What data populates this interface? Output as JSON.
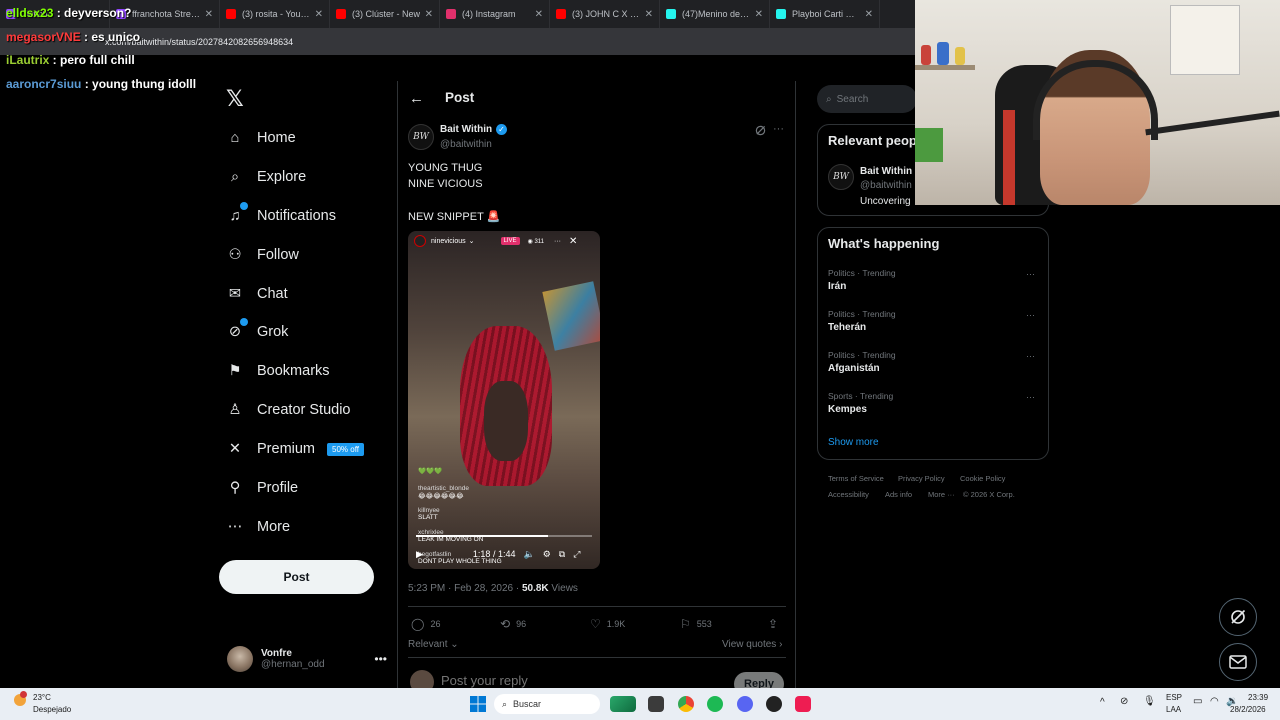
{
  "browser": {
    "tabs": [
      {
        "label": "Twitch",
        "color": "#9146ff"
      },
      {
        "label": "ffranchota Stream",
        "color": "#9146ff"
      },
      {
        "label": "(3) rosita - YouTube",
        "color": "#ff0000"
      },
      {
        "label": "(3) Clúster - New",
        "color": "#ff0000"
      },
      {
        "label": "(4) Instagram",
        "color": "#e1306c"
      },
      {
        "label": "(3) JOHN C X EZE",
        "color": "#ff0000"
      },
      {
        "label": "(47)Menino de Ou",
        "color": "#25f4ee"
      },
      {
        "label": "Playboi Carti Rele",
        "color": "#25f4ee"
      }
    ],
    "url": "x.com/baitwithin/status/2027842082656948634"
  },
  "chat": [
    {
      "user": "elldsx23",
      "color": "#7fff00",
      "text": "deyverson?"
    },
    {
      "user": "megasorVNE",
      "color": "#ff3b3b",
      "text": "es unico"
    },
    {
      "user": "iLautrix",
      "color": "#9acd32",
      "text": "pero full chill"
    },
    {
      "user": "aaroncr7siuu",
      "color": "#5b9bd5",
      "text": "young thung idolll"
    }
  ],
  "nav": {
    "items": [
      {
        "label": "Home",
        "icon": "home-icon",
        "glyph": "⌂"
      },
      {
        "label": "Explore",
        "icon": "search-icon",
        "glyph": "⌕"
      },
      {
        "label": "Notifications",
        "icon": "bell-icon",
        "glyph": "♫"
      },
      {
        "label": "Follow",
        "icon": "person-plus-icon",
        "glyph": "⚇"
      },
      {
        "label": "Chat",
        "icon": "mail-icon",
        "glyph": "✉"
      },
      {
        "label": "Grok",
        "icon": "grok-icon",
        "glyph": "⊘"
      },
      {
        "label": "Bookmarks",
        "icon": "bookmark-icon",
        "glyph": "⚑"
      },
      {
        "label": "Creator Studio",
        "icon": "creator-icon",
        "glyph": "♙"
      },
      {
        "label": "Premium",
        "icon": "x-logo-icon",
        "glyph": "✕"
      },
      {
        "label": "Profile",
        "icon": "person-icon",
        "glyph": "⚲"
      },
      {
        "label": "More",
        "icon": "more-circle-icon",
        "glyph": "⋯"
      }
    ],
    "premium_promo": "50% off",
    "post_button": "Post",
    "account": {
      "name": "Vonfre",
      "handle": "@hernan_odd"
    }
  },
  "post": {
    "header": "Post",
    "author": {
      "name": "Bait Within",
      "handle": "@baitwithin",
      "avatar_text": "BW"
    },
    "text_lines": [
      "YOUNG THUG",
      "NINE VICIOUS",
      "NEW SNIPPET 🚨"
    ],
    "video": {
      "account": "ninevicious",
      "live": "LIVE",
      "viewers": "311",
      "comments": [
        {
          "user": "theartistic_blonde",
          "text": "😂😂😂😂😂😂"
        },
        {
          "user": "killnyee",
          "text": "SLATT"
        },
        {
          "user": "xchrixlee",
          "text": "LEAK IM MOVING ON"
        },
        {
          "user": "hegotfastlin",
          "text": "DONT PLAY WHOLE THING"
        }
      ],
      "time": "1:18 / 1:44",
      "progress": 0.75
    },
    "timestamp": "5:23 PM · Feb 28, 2026 ·",
    "views_count": "50.8K",
    "views_label": "Views",
    "actions": {
      "replies": "26",
      "reposts": "96",
      "likes": "1.9K",
      "bookmarks": "553"
    },
    "sort_label": "Relevant",
    "view_quotes": "View quotes",
    "reply_placeholder": "Post your reply",
    "reply_button": "Reply"
  },
  "sidebar": {
    "search_placeholder": "Search",
    "relevant_title": "Relevant people",
    "relevant_person": {
      "name": "Bait Within",
      "handle": "@baitwithin",
      "bio": "Uncovering"
    },
    "happening_title": "What's happening",
    "trends": [
      {
        "category": "Politics · Trending",
        "name": "Irán"
      },
      {
        "category": "Politics · Trending",
        "name": "Teherán"
      },
      {
        "category": "Politics · Trending",
        "name": "Afganistán"
      },
      {
        "category": "Sports · Trending",
        "name": "Kempes"
      }
    ],
    "show_more": "Show more",
    "footer": [
      "Terms of Service",
      "Privacy Policy",
      "Cookie Policy",
      "Accessibility",
      "Ads info",
      "More ···",
      "© 2026 X Corp."
    ]
  },
  "taskbar": {
    "temp": "23°C",
    "weather": "Despejado",
    "search": "Buscar",
    "lang": "ESP",
    "lang2": "LAA",
    "time": "23:39",
    "date": "28/2/2026"
  }
}
